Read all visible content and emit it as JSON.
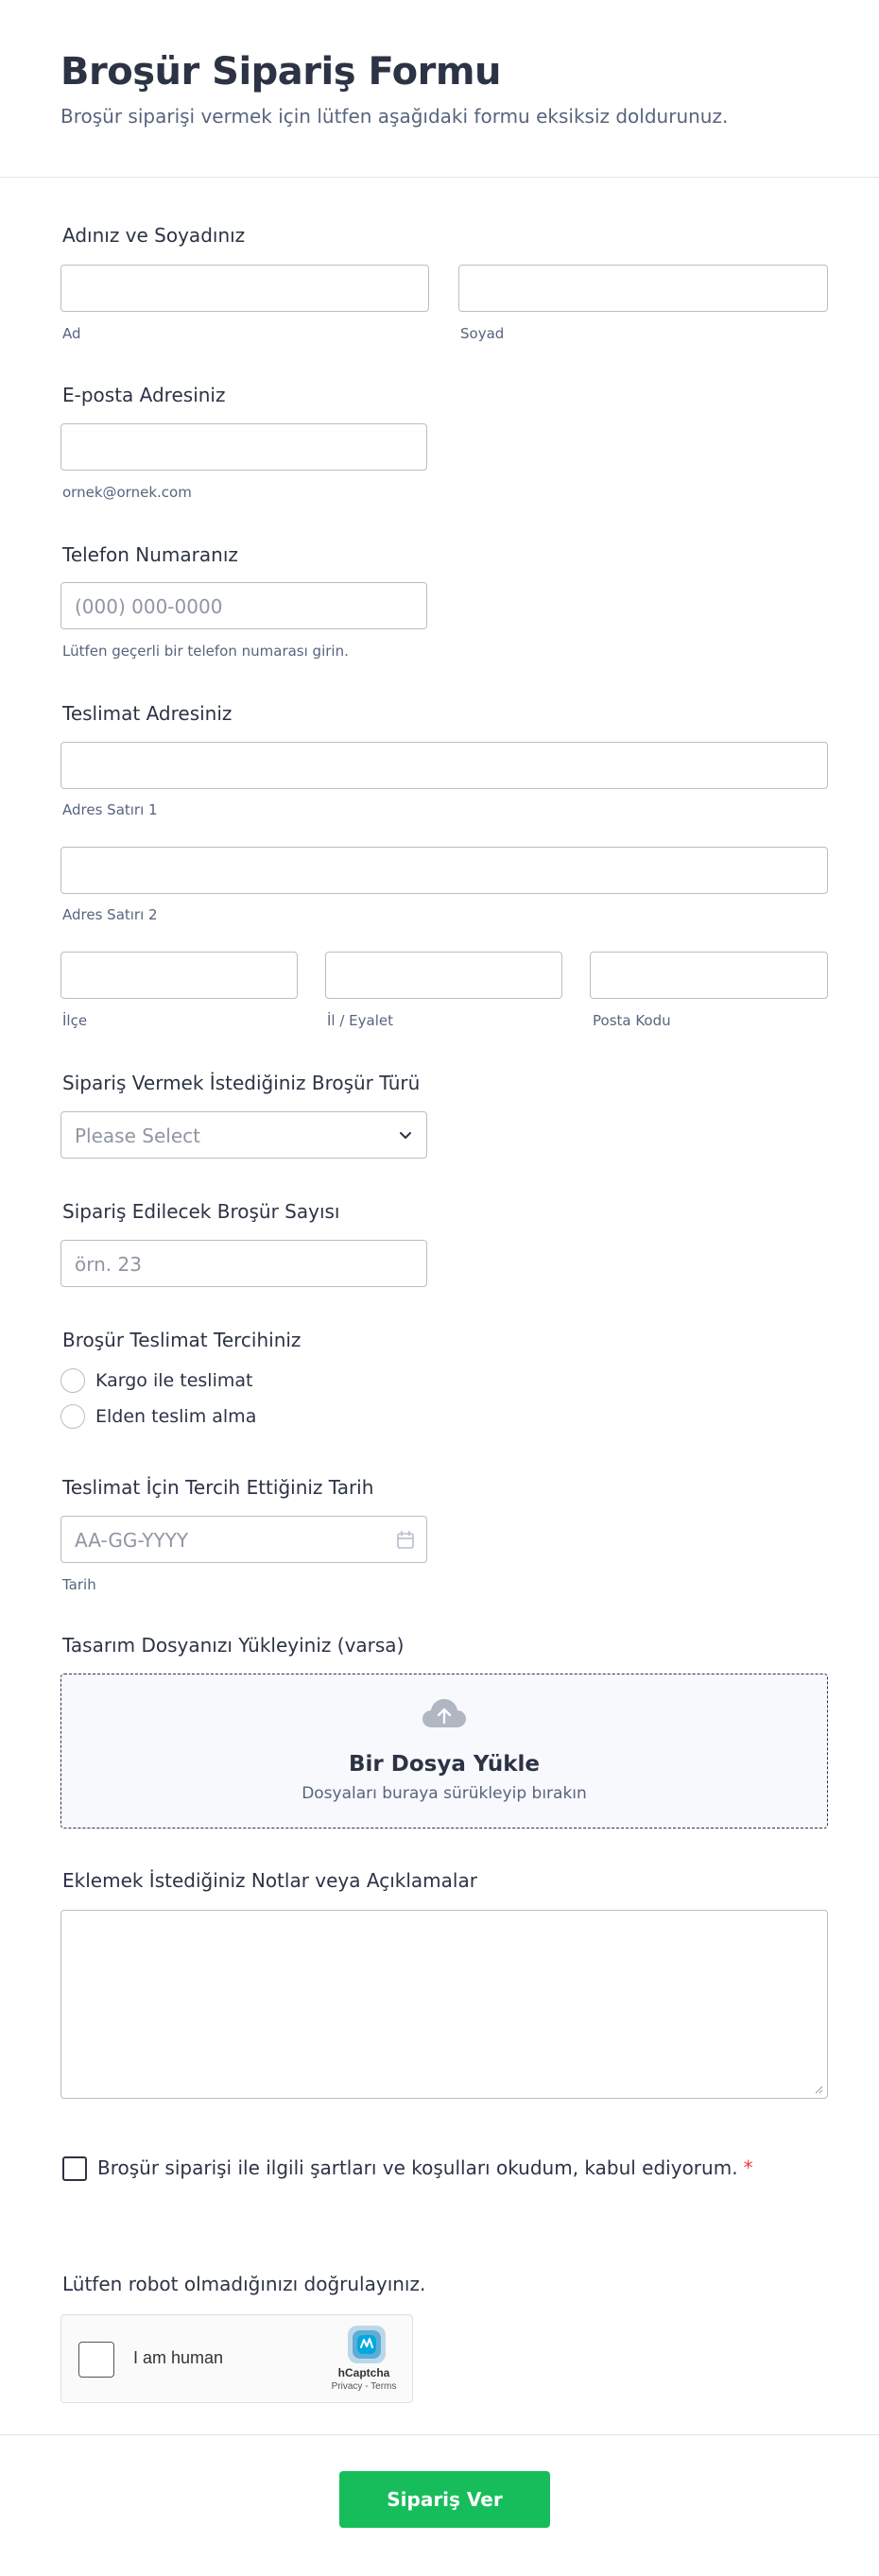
{
  "header": {
    "title": "Broşür Sipariş Formu",
    "subtitle": "Broşür siparişi vermek için lütfen aşağıdaki formu eksiksiz doldurunuz."
  },
  "name": {
    "label": "Adınız ve Soyadınız",
    "first_sublabel": "Ad",
    "last_sublabel": "Soyad"
  },
  "email": {
    "label": "E-posta Adresiniz",
    "sublabel": "ornek@ornek.com"
  },
  "phone": {
    "label": "Telefon Numaranız",
    "placeholder": "(000) 000-0000",
    "sublabel": "Lütfen geçerli bir telefon numarası girin."
  },
  "address": {
    "label": "Teslimat Adresiniz",
    "line1_sublabel": "Adres Satırı 1",
    "line2_sublabel": "Adres Satırı 2",
    "district_sublabel": "İlçe",
    "state_sublabel": "İl / Eyalet",
    "postal_sublabel": "Posta Kodu"
  },
  "brochure_type": {
    "label": "Sipariş Vermek İstediğiniz Broşür Türü",
    "placeholder": "Please Select"
  },
  "quantity": {
    "label": "Sipariş Edilecek Broşür Sayısı",
    "placeholder": "örn. 23"
  },
  "delivery": {
    "label": "Broşür Teslimat Tercihiniz",
    "options": [
      "Kargo ile teslimat",
      "Elden teslim alma"
    ]
  },
  "date": {
    "label": "Teslimat İçin Tercih Ettiğiniz Tarih",
    "placeholder": "AA-GG-YYYY",
    "sublabel": "Tarih"
  },
  "upload": {
    "label": "Tasarım Dosyanızı Yükleyiniz (varsa)",
    "title": "Bir Dosya Yükle",
    "subtitle": "Dosyaları buraya sürükleyip bırakın"
  },
  "notes": {
    "label": "Eklemek İstediğiniz Notlar veya Açıklamalar"
  },
  "terms": {
    "text": "Broşür siparişi ile ilgili şartları ve koşulları okudum, kabul ediyorum.",
    "required_mark": "*"
  },
  "captcha": {
    "label": "Lütfen robot olmadığınızı doğrulayınız.",
    "checkbox_text": "I am human",
    "brand": "hCaptcha",
    "links": "Privacy - Terms"
  },
  "submit": {
    "label": "Sipariş Ver"
  },
  "colors": {
    "accent": "#18bd5b",
    "text": "#2c3345",
    "muted": "#57647e",
    "border": "#b8bdc9",
    "required": "#f23a3c"
  }
}
